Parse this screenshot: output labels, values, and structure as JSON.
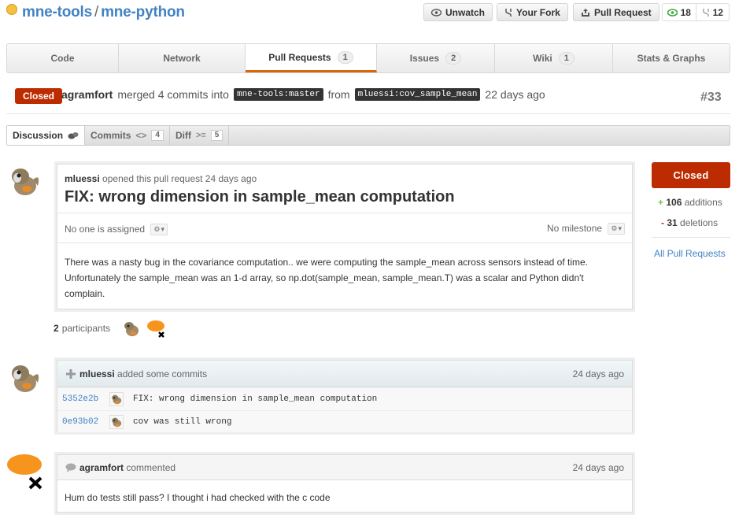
{
  "repo": {
    "owner": "mne-tools",
    "separator": "/",
    "name": "mne-python"
  },
  "header_buttons": {
    "unwatch": "Unwatch",
    "your_fork": "Your Fork",
    "pull_request": "Pull Request",
    "watchers": "18",
    "forks": "12"
  },
  "tabs": [
    {
      "label": "Code",
      "count": ""
    },
    {
      "label": "Network",
      "count": ""
    },
    {
      "label": "Pull Requests",
      "count": "1"
    },
    {
      "label": "Issues",
      "count": "2"
    },
    {
      "label": "Wiki",
      "count": "1"
    },
    {
      "label": "Stats & Graphs",
      "count": ""
    }
  ],
  "merge_info": {
    "state": "Closed",
    "author": "agramfort",
    "merged_text": "merged 4 commits into",
    "base_branch": "mne-tools:master",
    "from": "from",
    "head_branch": "mluessi:cov_sample_mean",
    "time": "22 days ago",
    "number": "#33"
  },
  "subtabs": [
    {
      "label": "Discussion",
      "count": ""
    },
    {
      "label": "Commits",
      "count": "4"
    },
    {
      "label": "Diff",
      "count": "5"
    }
  ],
  "discussion": {
    "opener": "mluessi",
    "opened_text": "opened this pull request 24 days ago",
    "title": "FIX: wrong dimension in sample_mean computation",
    "assignee": "No one is assigned",
    "milestone": "No milestone",
    "body": "There was a nasty bug in the covariance computation.. we were computing the sample_mean across sensors instead of time. Unfortunately the sample_mean was an 1-d array, so np.dot(sample_mean, sample_mean.T) was a scalar and Python didn't complain."
  },
  "participants": {
    "count": "2",
    "label": "participants"
  },
  "sidebar": {
    "state": "Closed",
    "additions_sign": "+",
    "additions": "106",
    "additions_label": "additions",
    "deletions_sign": "-",
    "deletions": "31",
    "deletions_label": "deletions",
    "all_prs": "All Pull Requests"
  },
  "commits_block": {
    "author": "mluessi",
    "action": "added some commits",
    "time": "24 days ago",
    "commits": [
      {
        "sha": "5352e2b",
        "message": "FIX: wrong dimension in sample_mean computation"
      },
      {
        "sha": "0e93b02",
        "message": "cov was still wrong"
      }
    ]
  },
  "comment": {
    "author": "agramfort",
    "action": "commented",
    "time": "24 days ago",
    "body": "Hum do tests still pass? I thought i had checked with the c code"
  },
  "colors": {
    "link": "#4183c4",
    "closed": "#bd2c00",
    "tab_accent": "#d26911",
    "additions": "#6cc644"
  }
}
